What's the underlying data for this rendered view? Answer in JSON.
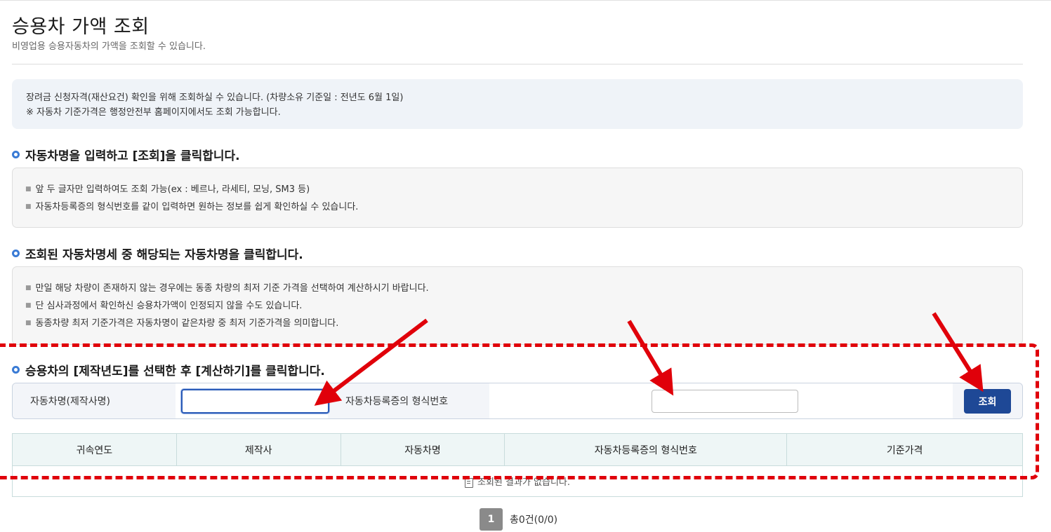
{
  "page": {
    "title": "승용차 가액 조회",
    "subtitle": "비영업용 승용자동차의 가액을 조회할 수 있습니다."
  },
  "notice": {
    "line1": "장려금 신청자격(재산요건) 확인을 위해 조회하실 수 있습니다. (차량소유 기준일 : 전년도 6월 1일)",
    "line2": "※ 자동차 기준가격은 행정안전부 홈페이지에서도 조회 가능합니다."
  },
  "steps": [
    {
      "title": "자동차명을 입력하고 [조회]을 클릭합니다.",
      "items": [
        "앞 두 글자만 입력하여도 조회 가능(ex : 베르나, 라세티, 모닝, SM3 등)",
        "자동차등록증의 형식번호를 같이 입력하면 원하는 정보를 쉽게 확인하실 수 있습니다."
      ]
    },
    {
      "title": "조회된 자동차명세 중 해당되는 자동차명을 클릭합니다.",
      "items": [
        "만일 해당 차량이 존재하지 않는 경우에는 동종 차량의 최저 기준 가격을 선택하여 계산하시기 바랍니다.",
        "단 심사과정에서 확인하신 승용차가액이 인정되지 않을 수도 있습니다.",
        "동종차량 최저 기준가격은 자동차명이 같은차량 중  최저 기준가격을 의미합니다."
      ]
    },
    {
      "title": "승용차의 [제작년도]를 선택한 후 [계산하기]를 클릭합니다."
    }
  ],
  "search": {
    "name_label": "자동차명(제작사명)",
    "name_value": "",
    "model_label": "자동차등록증의 형식번호",
    "model_value": "",
    "button_label": "조회"
  },
  "table": {
    "headers": [
      "귀속연도",
      "제작사",
      "자동차명",
      "자동차등록증의 형식번호",
      "기준가격"
    ],
    "empty_message": "조회된 결과가 없습니다."
  },
  "pagination": {
    "current_page": "1",
    "summary": "총0건(0/0)"
  },
  "annotation": {
    "color": "#e0000a"
  }
}
